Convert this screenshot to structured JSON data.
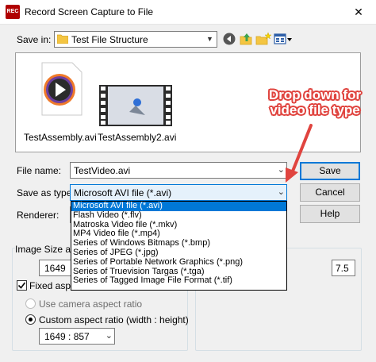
{
  "window": {
    "title": "Record Screen Capture to File",
    "app_icon_text": "REC",
    "close_glyph": "✕"
  },
  "save_in": {
    "label": "Save in:",
    "value": "Test File Structure"
  },
  "files": [
    {
      "name": "TestAssembly.avi",
      "icon": "media-play-icon"
    },
    {
      "name": "TestAssembly2.avi",
      "icon": "video-thumbnail-icon"
    }
  ],
  "file_name": {
    "label": "File name:",
    "value": "TestVideo.avi"
  },
  "save_as_type": {
    "label": "Save as type:",
    "value": "Microsoft AVI file (*.avi)",
    "options": [
      "Microsoft AVI file (*.avi)",
      "Flash Video (*.flv)",
      "Matroska Video file (*.mkv)",
      "MP4 Video file (*.mp4)",
      "Series of Windows Bitmaps (*.bmp)",
      "Series of JPEG (*.jpg)",
      "Series of Portable Network Graphics (*.png)",
      "Series of Truevision Targas (*.tga)",
      "Series of Tagged Image File Format (*.tif)"
    ],
    "selected_index": 0
  },
  "renderer": {
    "label": "Renderer:"
  },
  "buttons": {
    "save": "Save",
    "cancel": "Cancel",
    "help": "Help"
  },
  "image_size": {
    "group_label": "Image Size and",
    "width_value": "1649",
    "fixed_aspect_label": "Fixed aspec",
    "fixed_aspect_checked": true,
    "camera_aspect_label": "Use camera aspect ratio",
    "custom_aspect_label": "Custom aspect ratio (width : height)",
    "custom_aspect_value": "1649 : 857"
  },
  "frame_rate": {
    "value": "7.5"
  },
  "annotation": {
    "line1": "Drop down for",
    "line2": "video file type"
  },
  "colors": {
    "accent": "#0078d7",
    "annotation": "#e0443f",
    "window_bg": "#f0f0f0"
  }
}
